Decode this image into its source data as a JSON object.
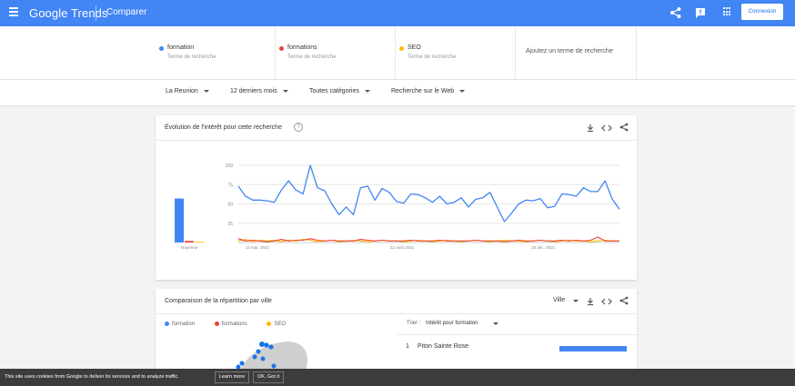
{
  "header": {
    "logo": "Google Trends",
    "title": "Comparer",
    "login_label": "Connexion",
    "color": "#4285f4"
  },
  "terms": [
    {
      "name": "formation",
      "sub": "Terme de recherche",
      "color": "#4285f4"
    },
    {
      "name": "formations",
      "sub": "Terme de recherche",
      "color": "#ea4335"
    },
    {
      "name": "SEO",
      "sub": "Terme de recherche",
      "color": "#fbbc04"
    }
  ],
  "add_term_placeholder": "Ajoutez un terme de recherche",
  "filters": {
    "region": "La Reunion",
    "period": "12 derniers mois",
    "category": "Toutes catégories",
    "search_type": "Recherche sur le Web"
  },
  "interest_card": {
    "title": "Évolution de l'intérêt pour cette recherche",
    "help": "?"
  },
  "chart_data": {
    "type": "line",
    "ylim": [
      0,
      100
    ],
    "yticks": [
      25,
      50,
      75,
      100
    ],
    "x_labels": [
      "14 mar. 2021",
      "22 août 2021",
      "26 déc. 2021"
    ],
    "average_label": "Moyenne",
    "averages": [
      57,
      2,
      1
    ],
    "series": [
      {
        "name": "formation",
        "color": "#4285f4",
        "values": [
          73,
          60,
          55,
          55,
          54,
          52,
          68,
          80,
          68,
          63,
          100,
          71,
          67,
          50,
          36,
          46,
          36,
          71,
          73,
          55,
          70,
          65,
          53,
          51,
          63,
          62,
          58,
          52,
          60,
          50,
          52,
          58,
          46,
          56,
          58,
          65,
          46,
          27,
          38,
          50,
          55,
          54,
          57,
          45,
          47,
          63,
          62,
          60,
          71,
          66,
          66,
          80,
          56,
          43
        ]
      },
      {
        "name": "formations",
        "color": "#ea4335",
        "values": [
          5,
          2,
          3,
          2,
          1,
          2,
          4,
          2,
          3,
          3,
          5,
          3,
          2,
          3,
          2,
          2,
          2,
          4,
          3,
          2,
          3,
          2,
          2,
          2,
          3,
          2,
          2,
          2,
          3,
          2,
          2,
          2,
          2,
          3,
          2,
          2,
          2,
          1,
          2,
          3,
          2,
          2,
          3,
          2,
          2,
          3,
          2,
          3,
          2,
          3,
          7,
          2,
          2,
          2
        ]
      },
      {
        "name": "SEO",
        "color": "#fbbc04",
        "values": [
          2,
          4,
          1,
          3,
          2,
          3,
          1,
          3,
          2,
          4,
          3,
          1,
          2,
          3,
          1,
          2,
          3,
          2,
          1,
          2,
          3,
          2,
          2,
          1,
          2,
          3,
          2,
          1,
          2,
          3,
          2,
          1,
          2,
          3,
          2,
          1,
          2,
          3,
          2,
          2,
          1,
          2,
          3,
          2,
          1,
          2,
          3,
          2,
          2,
          1,
          2,
          3,
          2,
          2
        ]
      }
    ]
  },
  "city_card": {
    "title": "Comparaison de la répartition par ville",
    "scope": "Ville",
    "sort_label": "Trier :",
    "sort_value": "Intérêt pour formation",
    "legend": [
      {
        "name": "formation",
        "color": "#4285f4"
      },
      {
        "name": "formations",
        "color": "#ea4335"
      },
      {
        "name": "SEO",
        "color": "#fbbc04"
      }
    ],
    "rows": [
      {
        "rank": "1",
        "name": "Piton Sainte Rose",
        "bar": 1.0
      }
    ]
  },
  "cookie": {
    "message": "This site uses cookies from Google to deliver its services and to analyze traffic.",
    "learn_more": "Learn more",
    "ok": "OK, Got it"
  }
}
